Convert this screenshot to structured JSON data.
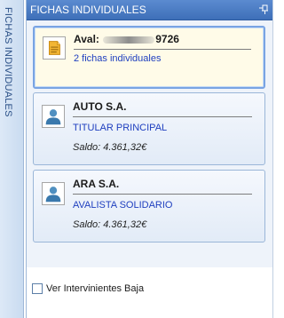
{
  "side_tab": {
    "label": "FICHAS INDIVIDUALES"
  },
  "panel": {
    "title": "FICHAS INDIVIDUALES",
    "pin_icon": "pin-icon"
  },
  "cards": [
    {
      "title_prefix": "Aval: ",
      "title_suffix": "9726",
      "link": "2 fichas individuales",
      "icon": "document-icon",
      "selected": true
    },
    {
      "title": "AUTO S.A.",
      "role": "TITULAR PRINCIPAL",
      "saldo": "Saldo: 4.361,32€",
      "icon": "person-icon"
    },
    {
      "title": "ARA S.A.",
      "role": "AVALISTA SOLIDARIO",
      "saldo": "Saldo: 4.361,32€",
      "icon": "person-icon"
    }
  ],
  "footer": {
    "checkbox_label": "Ver Intervinientes Baja",
    "checked": false
  },
  "colors": {
    "header": "#4a7cc4",
    "selected_border": "#79a4e3",
    "link": "#1f3fbf"
  }
}
